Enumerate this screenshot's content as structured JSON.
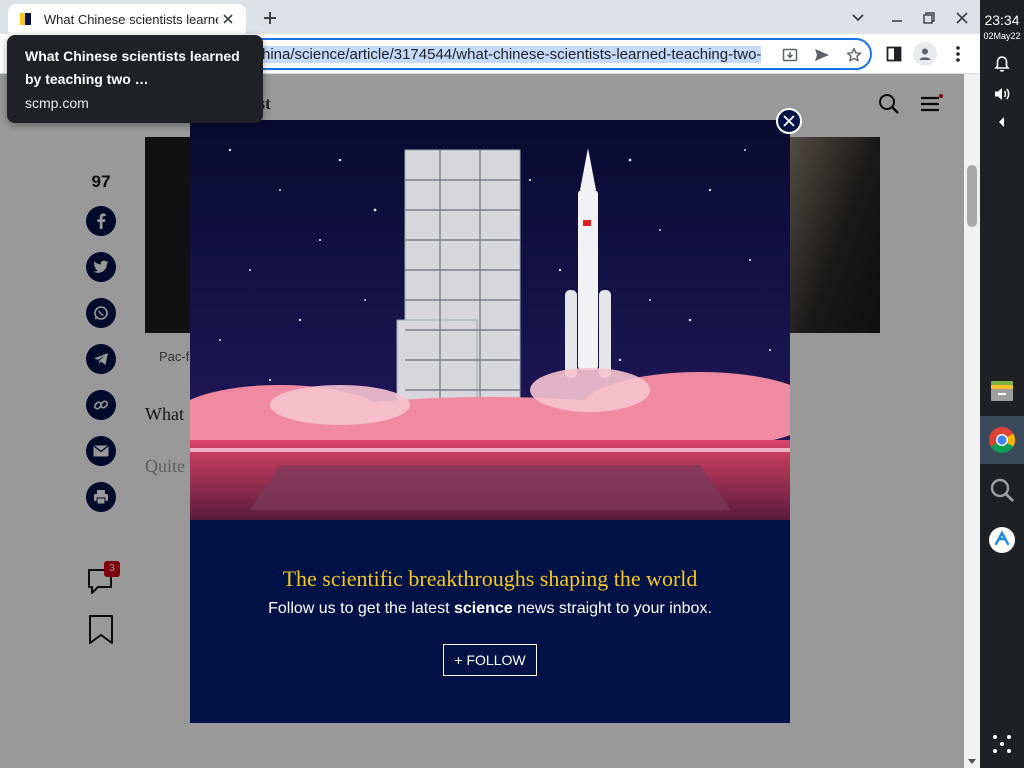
{
  "browser": {
    "tab_title": "What Chinese scientists learned by teaching two …",
    "url_prefix": "hina/science/article/3174544/what-chinese-scientists-learned-teaching-two-",
    "hover_card": {
      "title": "What Chinese scientists learned by teaching two …",
      "domain": "scmp.com"
    }
  },
  "page": {
    "logo_fragment": "ost",
    "caption_fragment": "Pac-f",
    "article_text_fragment": "What",
    "article_text_fragment2": "Quite",
    "share_count": "97",
    "comment_count": "3"
  },
  "modal": {
    "headline": "The scientific breakthroughs shaping the world",
    "sub_before": "Follow us to get the latest ",
    "sub_bold": "science",
    "sub_after": " news straight to your inbox.",
    "follow_label": "+ FOLLOW"
  },
  "shelf": {
    "time": "23:34",
    "date": "02May22"
  },
  "colors": {
    "brand_navy": "#001246",
    "brand_yellow": "#f6c624",
    "selection": "#c6dafc",
    "focus_blue": "#1a73e8"
  },
  "icons": [
    "close-icon",
    "plus-icon",
    "chevron-down-icon",
    "minimize-icon",
    "restore-icon",
    "install-icon",
    "send-icon",
    "star-icon",
    "side-panel-icon",
    "profile-icon",
    "more-vert-icon",
    "search-icon",
    "hamburger-icon",
    "facebook-icon",
    "twitter-icon",
    "whatsapp-icon",
    "telegram-icon",
    "link-icon",
    "mail-icon",
    "print-icon",
    "comment-icon",
    "bookmark-icon",
    "bell-icon",
    "volume-icon",
    "files-app-icon",
    "chrome-icon",
    "launcher-search-icon",
    "app-icon"
  ]
}
